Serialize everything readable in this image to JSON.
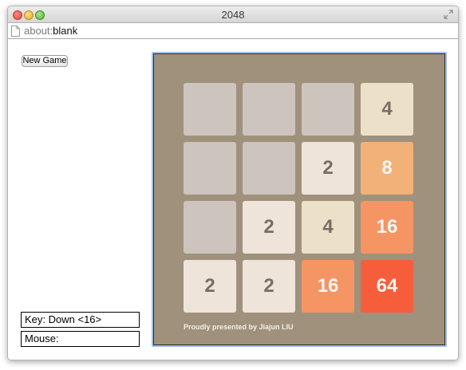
{
  "window": {
    "title": "2048"
  },
  "address_bar": {
    "scheme": "about:",
    "host": "blank"
  },
  "controls": {
    "new_game_label": "New Game"
  },
  "status": {
    "key": "Key: Down <16>",
    "mouse": "Mouse:"
  },
  "board": {
    "grid": [
      [
        null,
        null,
        null,
        4
      ],
      [
        null,
        null,
        2,
        8
      ],
      [
        null,
        2,
        4,
        16
      ],
      [
        2,
        2,
        16,
        64
      ]
    ],
    "credit": "Proudly presented by Jiajun LIU"
  },
  "colors": {
    "board_bg": "#a0917c",
    "empty": "#ccc4bd",
    "tile_2": "#eee4da",
    "tile_4": "#ede0c8",
    "tile_8": "#f2b179",
    "tile_16": "#f59563",
    "tile_64": "#f65e3b",
    "dark_text": "#776e65",
    "light_text": "#f9f6f2"
  }
}
